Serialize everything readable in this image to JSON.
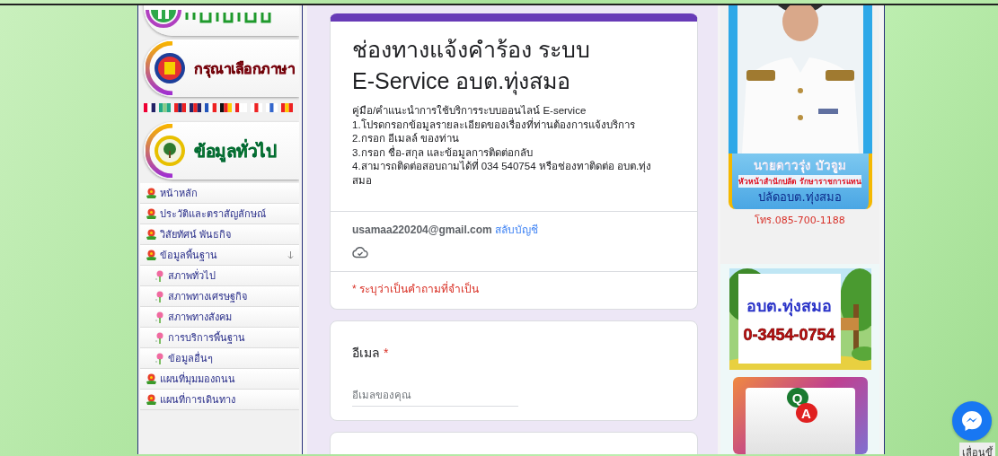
{
  "sidebar": {
    "banners": [
      {
        "kind": "home"
      },
      {
        "kind": "language",
        "title": "กรุณาเลือกภาษา"
      },
      {
        "kind": "info",
        "title": "ข้อมูลทั่วไป"
      }
    ],
    "menu": [
      {
        "label": "หน้าหลัก"
      },
      {
        "label": "ประวัติและตราสัญลักษณ์"
      },
      {
        "label": "วิสัยทัศน์ พันธกิจ"
      },
      {
        "label": "ข้อมูลพื้นฐาน",
        "expanded": true,
        "children": [
          {
            "label": "สภาพทั่วไป"
          },
          {
            "label": "สภาพทางเศรษฐกิจ"
          },
          {
            "label": "สภาพทางสังคม"
          },
          {
            "label": "การบริการพื้นฐาน"
          },
          {
            "label": "ข้อมูลอื่นๆ"
          }
        ]
      },
      {
        "label": "แผนที่มุมมองถนน"
      },
      {
        "label": "แผนที่การเดินทาง"
      }
    ]
  },
  "form": {
    "title": [
      "ช่องทางแจ้งคำร้อง ระบบ",
      "E-Service อบต.ทุ่งสมอ"
    ],
    "description": [
      "คู่มือ/คำแนะนำการใช้บริการระบบออนไลน์ E-service",
      "1.โปรดกรอกข้อมูลรายละเอียดของเรื่องที่ท่านต้องการแจ้งบริการ",
      "2.กรอก อีเมลล์ ของท่าน",
      "3.กรอก ชื่อ-สกุล และข้อมูลการติดต่อกลับ",
      "4.สามารถติดต่อสอบถามได้ที่ 034 540754 หรือช่องทาติดต่อ อบต.ทุ่ง",
      "สมอ"
    ],
    "account": {
      "email": "usamaa220204@gmail.com",
      "switch_label": "สลับบัญชี"
    },
    "required_note": "* ระบุว่าเป็นคำถามที่จำเป็น",
    "questions": [
      {
        "label": "อีเมล",
        "required_mark": "*",
        "placeholder": "อีเมลของคุณ"
      }
    ]
  },
  "right": {
    "official": {
      "name": "นายดาวรุ่ง บัวจูม",
      "position": "หัวหน้าสำนักปลัด รักษาราชการแทน",
      "office": "ปลัดอบต.ทุ่งสมอ",
      "phone": "โทร.085-700-1188"
    },
    "contact_banner": {
      "title": "อบต.ทุ่งสมอ",
      "phone": "0-3454-0754"
    },
    "qa": [
      "Q",
      "A"
    ]
  },
  "scroll_top_label": "เลื่อนขึ้"
}
